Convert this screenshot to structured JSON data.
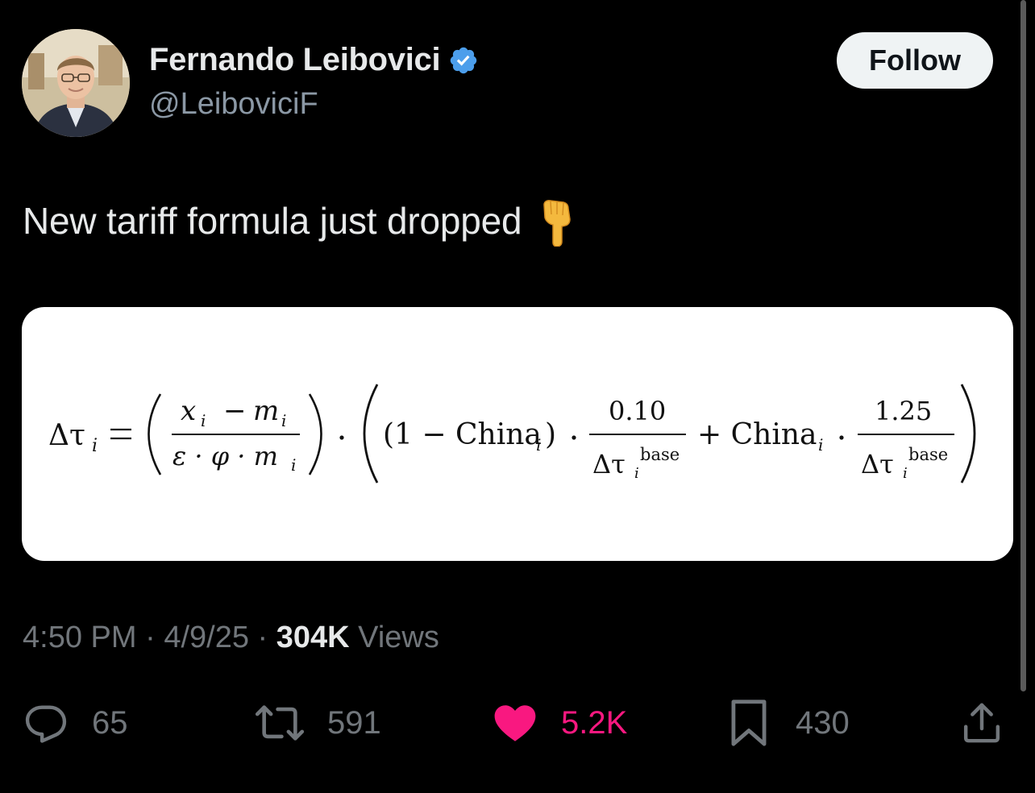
{
  "author": {
    "display_name": "Fernando Leibovici",
    "handle": "@LeiboviciF",
    "verified_icon": "verified-badge-icon",
    "verified_color": "#4c9eeb"
  },
  "follow_button": {
    "label": "Follow"
  },
  "post": {
    "text": "New tariff formula just dropped",
    "emoji": "👇"
  },
  "formula": {
    "lhs": "Δτ",
    "lhs_sub": "i",
    "frac1_num_x": "x",
    "frac1_num_sub": "i",
    "frac1_num_minus": "−",
    "frac1_num_m": "m",
    "frac1_den": "ε · φ · m",
    "frac1_den_sub": "i",
    "group_start": "(1 − China",
    "china_sub": "i",
    "frac2_num": "0.10",
    "frac2_den": "Δτ",
    "frac2_den_sup": "base",
    "frac2_den_sub": "i",
    "plus_china": "+ China",
    "frac3_num": "1.25",
    "frac3_den": "Δτ",
    "frac3_den_sup": "base",
    "frac3_den_sub": "i"
  },
  "meta": {
    "time": "4:50 PM",
    "separator": "·",
    "date": "4/9/25",
    "views_count": "304K",
    "views_label": "Views"
  },
  "actions": {
    "replies": {
      "icon": "reply-icon",
      "count": "65"
    },
    "reposts": {
      "icon": "repost-icon",
      "count": "591"
    },
    "likes": {
      "icon": "heart-icon",
      "count": "5.2K",
      "color": "#f91880"
    },
    "bookmarks": {
      "icon": "bookmark-icon",
      "count": "430"
    },
    "share": {
      "icon": "share-icon"
    }
  }
}
